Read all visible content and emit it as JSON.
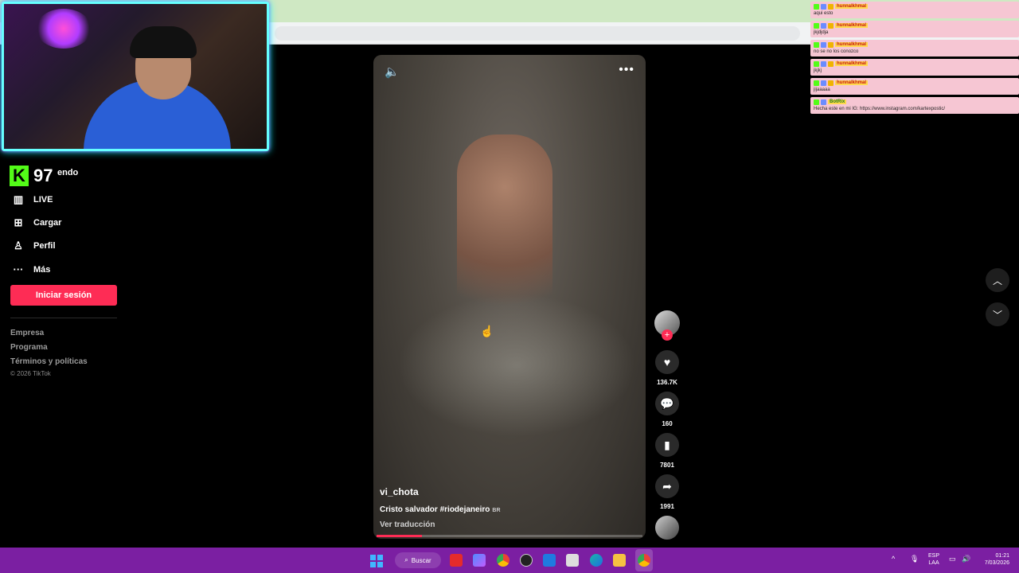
{
  "stream": {
    "kick_count": "97",
    "chat": [
      {
        "user": "hunnalkhmal",
        "text": "aqui esto"
      },
      {
        "user": "hunnalkhmal",
        "text": "jkjdjdja"
      },
      {
        "user": "hunnalkhmal",
        "text": "no se no los conozco"
      },
      {
        "user": "hunnalkhmal",
        "text": "jkjkj"
      },
      {
        "user": "hunnalkhmal",
        "text": "jijaaaaa"
      },
      {
        "user": "BotRix",
        "text": "Hecha este en mi IG: https://www.instagram.com/kartexpostic/"
      }
    ]
  },
  "sidebar": {
    "nav_peek": "endo",
    "items": [
      {
        "label": "LIVE",
        "icon": "live-icon"
      },
      {
        "label": "Cargar",
        "icon": "upload-icon"
      },
      {
        "label": "Perfil",
        "icon": "profile-icon"
      },
      {
        "label": "Más",
        "icon": "more-icon"
      }
    ],
    "login_label": "Iniciar sesión",
    "footer": [
      "Empresa",
      "Programa",
      "Términos y políticas"
    ],
    "copyright": "© 2026 TikTok"
  },
  "video": {
    "username": "vi_chota",
    "caption": "Cristo salvador #riodejaneiro",
    "caption_tag": "BR",
    "translate_label": "Ver traducción",
    "progress": 0.17
  },
  "actions": {
    "likes": "136.7K",
    "comments": "160",
    "saves": "7801",
    "shares": "1991"
  },
  "taskbar": {
    "search_label": "Buscar",
    "lang_top": "ESP",
    "lang_bottom": "LAA",
    "time": "01:21",
    "date": "7/03/2026"
  },
  "colors": {
    "accent": "#fe2c55",
    "taskbar": "#7b1fa2",
    "kick": "#53fc18"
  }
}
